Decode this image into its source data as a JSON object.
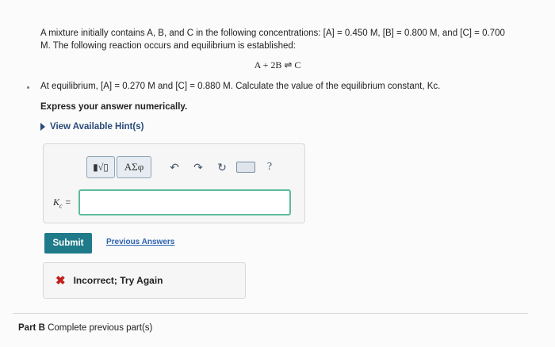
{
  "problem": {
    "line1": "A mixture initially contains A, B, and C in the following concentrations: [A] = 0.450 M, [B] = 0.800 M, and [C] = 0.700",
    "line2": "M. The following reaction occurs and equilibrium is established:",
    "reaction": "A + 2B ⇌ C",
    "equilibrium": "At equilibrium, [A] = 0.270 M and [C] = 0.880 M. Calculate the value of the equilibrium constant, Kc.",
    "express": "Express your answer numerically."
  },
  "hint": {
    "label": "View Available Hint(s)"
  },
  "toolbar": {
    "template_label": "▮√▯",
    "symbols_label": "ΑΣφ",
    "undo_glyph": "↶",
    "redo_glyph": "↷",
    "reset_glyph": "↻",
    "help_glyph": "?"
  },
  "answer": {
    "label_main": "K",
    "label_sub": "c",
    "label_eq": " =",
    "value": ""
  },
  "submit": {
    "label": "Submit"
  },
  "previous_answers": {
    "label": "Previous Answers"
  },
  "feedback": {
    "icon": "✖",
    "message": "Incorrect; Try Again"
  },
  "partb": {
    "label": "Part B",
    "text": " Complete previous part(s)"
  },
  "colors": {
    "accent": "#1f7a8a",
    "input_border": "#5bbc9e",
    "error": "#c0201c",
    "link": "#2c62b0"
  }
}
